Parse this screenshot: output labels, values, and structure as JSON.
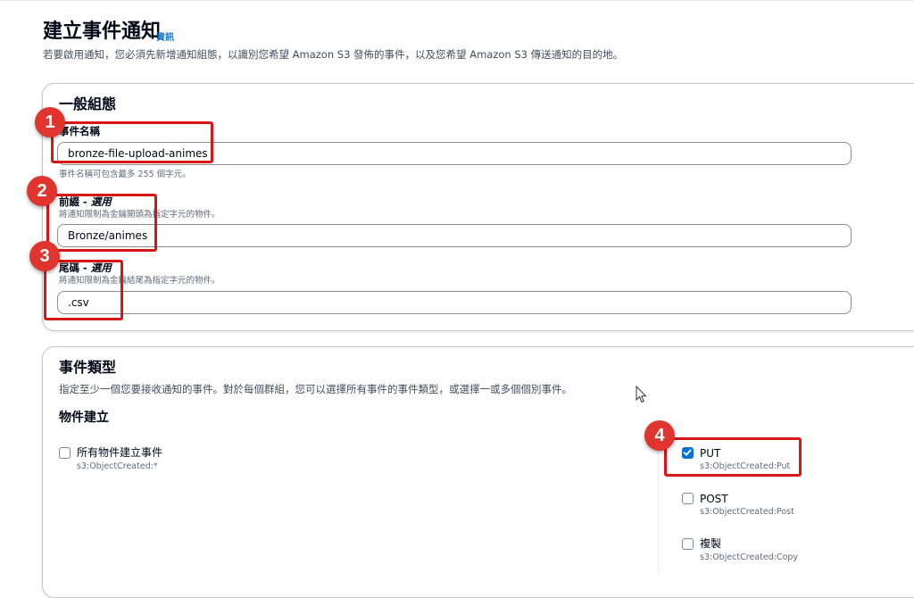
{
  "page": {
    "title": "建立事件通知",
    "info_link": "資訊",
    "description": "若要啟用通知，您必須先新增通知組態，以識別您希望 Amazon S3 發佈的事件，以及您希望 Amazon S3 傳送通知的目的地。"
  },
  "general": {
    "heading": "一般組態",
    "event_name": {
      "label": "事件名稱",
      "value": "bronze-file-upload-animes",
      "hint": "事件名稱可包含最多 255 個字元。"
    },
    "prefix": {
      "label": "前綴",
      "optional": " - 選用",
      "hint": "將通知限制為金鑰開頭為指定字元的物件。",
      "value": "Bronze/animes"
    },
    "suffix": {
      "label": "尾碼",
      "optional": " - 選用",
      "hint": "將通知限制為金鑰結尾為指定字元的物件。",
      "value": ".csv"
    }
  },
  "event_types": {
    "heading": "事件類型",
    "description": "指定至少一個您要接收通知的事件。對於每個群組，您可以選擇所有事件的事件類型，或選擇一或多個個別事件。",
    "group_heading": "物件建立",
    "all_created": {
      "label": "所有物件建立事件",
      "sub": "s3:ObjectCreated:*",
      "checked": false
    },
    "put": {
      "label": "PUT",
      "sub": "s3:ObjectCreated:Put",
      "checked": true
    },
    "post": {
      "label": "POST",
      "sub": "s3:ObjectCreated:Post",
      "checked": false
    },
    "copy": {
      "label": "複製",
      "sub": "s3:ObjectCreated:Copy",
      "checked": false
    }
  },
  "annotations": {
    "badge_1": "1",
    "badge_2": "2",
    "badge_3": "3",
    "badge_4": "4",
    "color": "#d91515"
  },
  "colors": {
    "accent": "#0972d3",
    "text": "#000716",
    "muted": "#5f6b7a"
  }
}
